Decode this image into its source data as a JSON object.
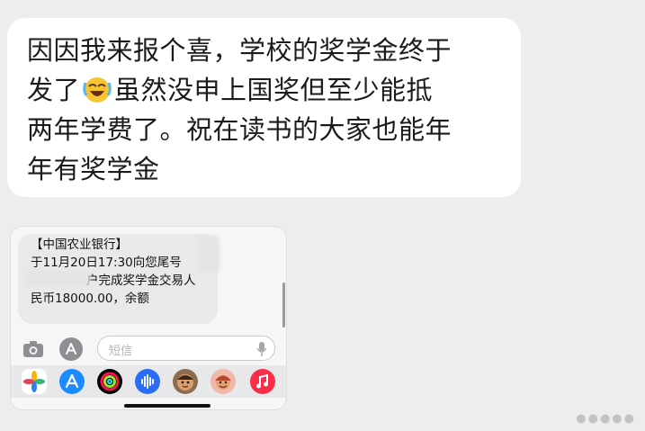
{
  "message": {
    "lines": [
      "因因我来报个喜，学校的奖学金终于",
      "虽然没申上国奖但至少能抵",
      "两年学费了。祝在读书的大家也能年",
      "年有奖学金"
    ],
    "line2_prefix": "发了",
    "emoji": "laughing-crying-face"
  },
  "sms_screenshot": {
    "lines": [
      "【中国农业银行】",
      "于11月20日17:30向您尾号",
      "户完成奖学金交易人",
      "民币18000.00，余额"
    ],
    "input_placeholder": "短信",
    "tray_icons": [
      "photos-icon",
      "app-store-icon",
      "fitness-icon",
      "audio-icon",
      "memoji-icon",
      "memoji-stickers-icon",
      "music-icon"
    ]
  },
  "colors": {
    "background": "#ededed",
    "bubble": "#ffffff",
    "app_store": "#1a8cff",
    "music": "#fa2d48"
  }
}
